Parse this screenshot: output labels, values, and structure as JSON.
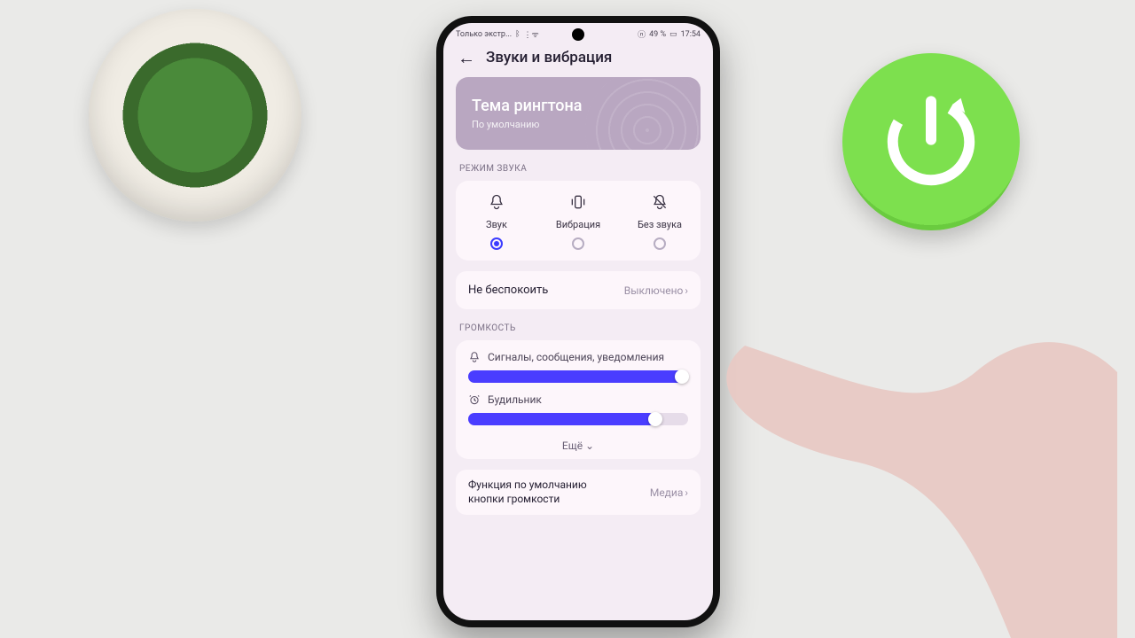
{
  "statusbar": {
    "carrier": "Только экстр...",
    "battery_text": "49 %",
    "time": "17:54"
  },
  "header": {
    "title": "Звуки и вибрация"
  },
  "theme_card": {
    "title": "Тема рингтона",
    "subtitle": "По умолчанию"
  },
  "sections": {
    "sound_mode_label": "РЕЖИМ ЗВУКА",
    "volume_label": "ГРОМКОСТЬ"
  },
  "sound_modes": [
    {
      "id": "sound",
      "label": "Звук",
      "selected": true
    },
    {
      "id": "vibrate",
      "label": "Вибрация",
      "selected": false
    },
    {
      "id": "silent",
      "label": "Без звука",
      "selected": false
    }
  ],
  "dnd": {
    "label": "Не беспокоить",
    "value": "Выключено"
  },
  "volume": {
    "notifications": {
      "label": "Сигналы, сообщения, уведомления",
      "percent": 100
    },
    "alarm": {
      "label": "Будильник",
      "percent": 85
    },
    "more_label": "Ещё"
  },
  "volume_key": {
    "label": "Функция по умолчанию кнопки громкости",
    "value": "Медиа"
  },
  "colors": {
    "accent": "#4a3dff",
    "card": "#fdf6fb",
    "theme_card_bg": "#b9a7c1"
  }
}
